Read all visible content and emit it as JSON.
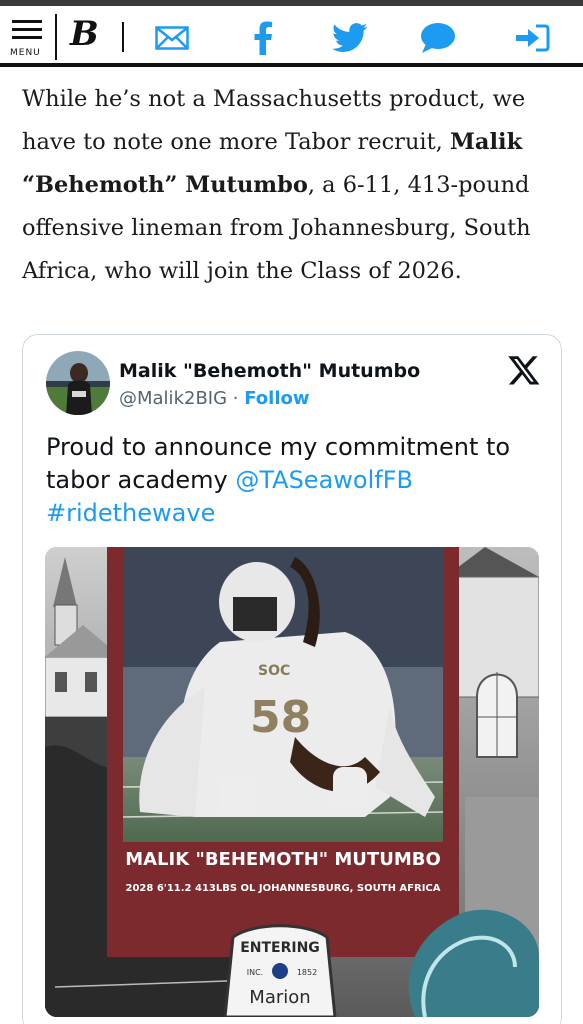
{
  "header": {
    "menu_label": "MENU",
    "logo_text": "B",
    "icons": [
      "menu-icon",
      "logo-icon",
      "mail-icon",
      "facebook-icon",
      "twitter-icon",
      "comment-icon",
      "login-icon"
    ]
  },
  "article": {
    "p1": "While he’s not a Massachusetts product, we have to note one more Tabor recruit, ",
    "bold_name": "Malik “Behemoth” Mutumbo",
    "p2": ", a 6-11, 413-pound offensive lineman from Johannesburg, South Africa, who will join the Class of 2026."
  },
  "tweet": {
    "display_name": "Malik \"Behemoth\" Mutumbo",
    "handle": "@Malik2BIG",
    "separator": " · ",
    "follow_label": "Follow",
    "text_before": "Proud to announce my commitment to tabor academy ",
    "mention": "@TASeawolfFB",
    "hashtag": "#ridethewave",
    "graphic": {
      "jersey_text": "SOC",
      "jersey_number": "58",
      "name_banner": "MALIK \"BEHEMOTH\" MUTUMBO",
      "details": "2028 6'11.2  413LBS OL  JOHANNESBURG, SOUTH AFRICA",
      "sign_top": "ENTERING",
      "sign_inc": "INC.",
      "sign_year": "1852",
      "sign_town": "Marion"
    }
  },
  "colors": {
    "link": "#1d9bf0",
    "maroon": "#7d2a2e",
    "header_border": "#111111"
  }
}
